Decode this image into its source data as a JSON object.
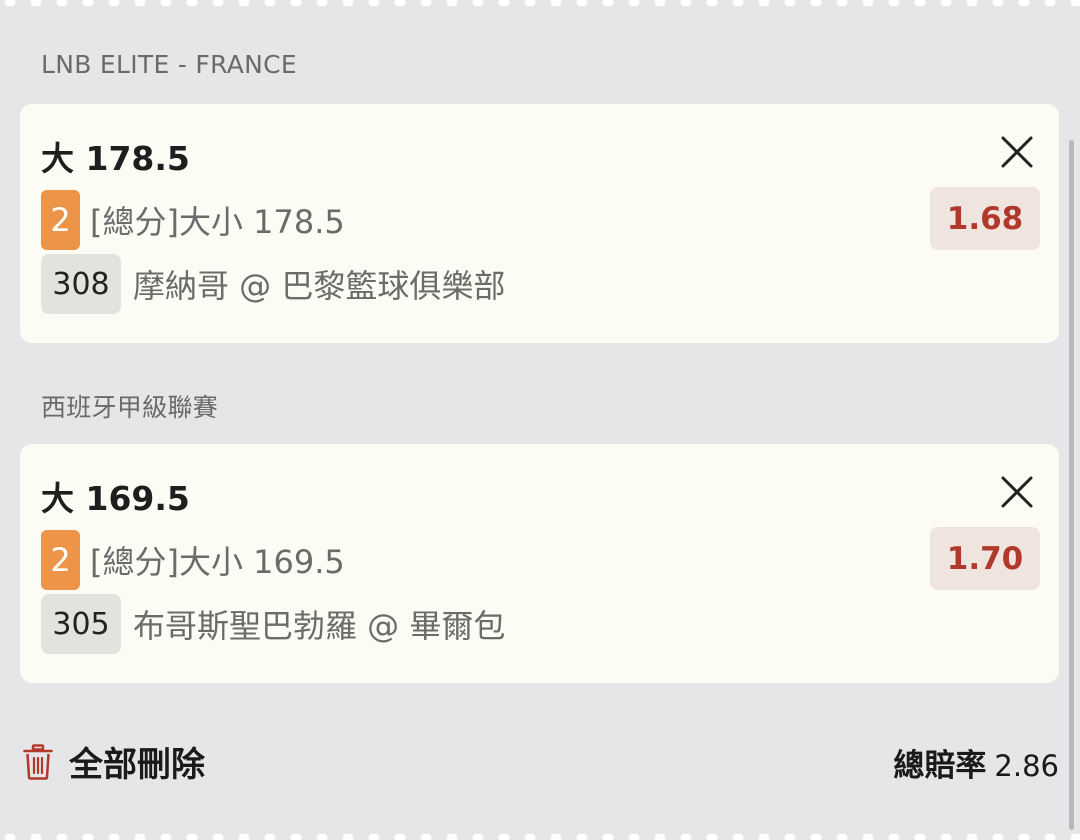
{
  "bets": [
    {
      "league": "LNB ELITE - FRANCE",
      "title": "大 178.5",
      "market_badge": "2",
      "market": "[總分]大小 178.5",
      "match_no": "308",
      "match": "摩納哥 @ 巴黎籃球俱樂部",
      "odds": "1.68"
    },
    {
      "league": "西班牙甲級聯賽",
      "title": "大 169.5",
      "market_badge": "2",
      "market": "[總分]大小 169.5",
      "match_no": "305",
      "match": "布哥斯聖巴勃羅 @ 畢爾包",
      "odds": "1.70"
    }
  ],
  "footer": {
    "delete_all_label": "全部刪除",
    "total_odds_label": "總賠率",
    "total_odds_value": "2.86"
  },
  "colors": {
    "background": "#e6e6e8",
    "card": "#fcfbf4",
    "market_badge": "#ec9447",
    "odds_text": "#b0392c",
    "odds_bg": "#f0e4de",
    "trash_icon": "#b0392c"
  },
  "icons": {
    "close": "close-icon",
    "delete": "trash-icon"
  }
}
